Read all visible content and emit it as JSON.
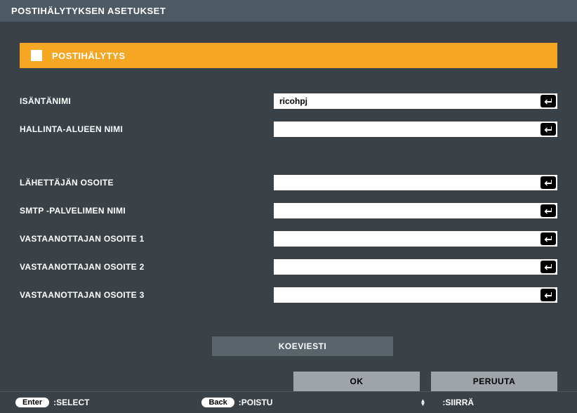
{
  "header": {
    "title": "POSTIHÄLYTYKSEN ASETUKSET"
  },
  "banner": {
    "label": "POSTIHÄLYTYS",
    "checked": false
  },
  "fields": {
    "hostname": {
      "label": "ISÄNTÄNIMI",
      "value": "ricohpj"
    },
    "domain": {
      "label": "HALLINTA-ALUEEN NIMI",
      "value": ""
    },
    "sender": {
      "label": "LÄHETTÄJÄN OSOITE",
      "value": ""
    },
    "smtp": {
      "label": "SMTP -PALVELIMEN NIMI",
      "value": ""
    },
    "recipient1": {
      "label": "VASTAANOTTAJAN OSOITE 1",
      "value": ""
    },
    "recipient2": {
      "label": "VASTAANOTTAJAN OSOITE 2",
      "value": ""
    },
    "recipient3": {
      "label": "VASTAANOTTAJAN OSOITE 3",
      "value": ""
    }
  },
  "buttons": {
    "test": "KOEVIESTI",
    "ok": "OK",
    "cancel": "PERUUTA"
  },
  "footer": {
    "enter_key": "Enter",
    "enter_action": ":SELECT",
    "back_key": "Back",
    "back_action": ":POISTU",
    "move_action": ":SIIRRÄ"
  }
}
